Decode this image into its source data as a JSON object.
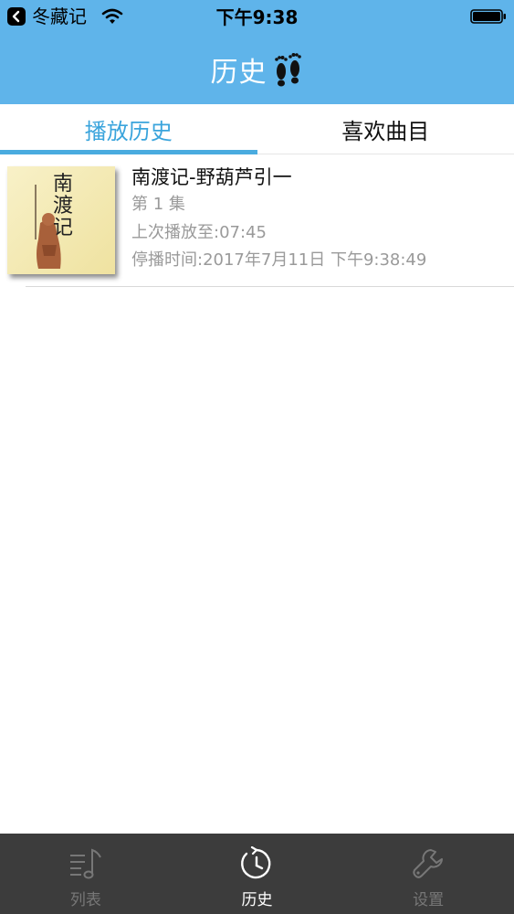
{
  "status_bar": {
    "back_app": "冬藏记",
    "time": "下午9:38",
    "icons": [
      "back-arrow-icon",
      "wifi-icon",
      "battery-icon"
    ]
  },
  "nav": {
    "title": "历史",
    "icon": "footprints-icon"
  },
  "tabs": [
    {
      "label": "播放历史",
      "active": true
    },
    {
      "label": "喜欢曲目",
      "active": false
    }
  ],
  "history": [
    {
      "title": "南渡记-野葫芦引一",
      "episode": "第 1 集",
      "last_played": "上次播放至:07:45",
      "stop_time": "停播时间:2017年7月11日 下午9:38:49",
      "cover_text": "南渡记"
    }
  ],
  "tab_bar": [
    {
      "label": "列表",
      "icon": "music-list-icon",
      "active": false
    },
    {
      "label": "历史",
      "icon": "clock-icon",
      "active": true
    },
    {
      "label": "设置",
      "icon": "wrench-icon",
      "active": false
    }
  ],
  "colors": {
    "accent": "#5fb4ea",
    "active_tab": "#3aa4dc",
    "tab_bar_bg": "#3c3c3c",
    "meta_text": "#9a9a9a"
  }
}
